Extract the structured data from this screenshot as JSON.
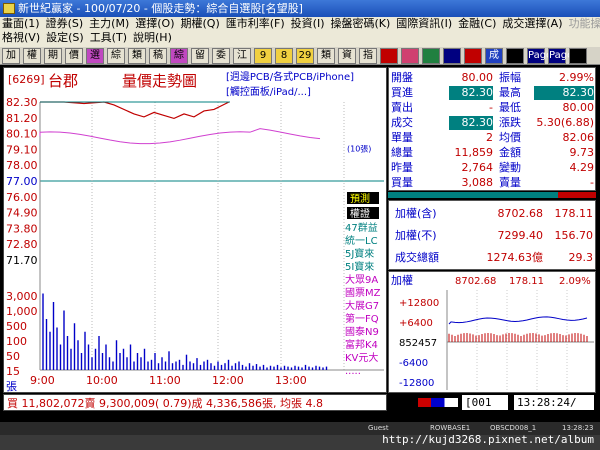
{
  "window": {
    "title": "新世紀贏家 - 100/07/20 - 個股走勢：綜合自選股[名望股]"
  },
  "menu": {
    "row1": [
      "畫面(1)",
      "證券(S)",
      "主力(M)",
      "選擇(O)",
      "期權(Q)",
      "匯市利率(F)",
      "投資(I)",
      "操盤密碼(K)",
      "國際資訊(I)",
      "金融(C)",
      "成交選擇(A)",
      "功能操作(F)"
    ],
    "row2": [
      "格視(V)",
      "設定(S)",
      "工具(T)",
      "說明(H)"
    ]
  },
  "toolbar": {
    "buttons": [
      "加",
      "權",
      "期",
      "價",
      "選",
      "綜",
      "類",
      "稿",
      "綜",
      "留",
      "委",
      "江",
      "9",
      "8",
      "29",
      "類",
      "資",
      "指",
      "",
      "",
      "",
      "",
      "",
      "成",
      "",
      "Page",
      "Page",
      ""
    ]
  },
  "stock": {
    "code": "[6269]",
    "name": "台郡",
    "chart_title": "量價走勢圖",
    "tag1": "[週邊PCB/各式PCB/iPhone]",
    "tag2": "[觸控面板/iPad/...]"
  },
  "price_axis": [
    "82.30",
    "81.20",
    "80.10",
    "79.10",
    "78.00",
    "77.00",
    "76.00",
    "74.90",
    "73.80",
    "72.80",
    "71.70"
  ],
  "volume_axis": [
    "3,000",
    "1,000",
    "500",
    "100",
    "50",
    "15",
    "張"
  ],
  "time_axis": [
    "9:00",
    "10:00",
    "11:00",
    "12:00",
    "13:00"
  ],
  "side_labels": {
    "predict": "預測",
    "ratio": "權證",
    "thousand": "(10張)",
    "list": [
      "47群益",
      "統一LC",
      "5J寶來",
      "5I寶來",
      "大眾9A",
      "國票MZ",
      "大展G7",
      "第一FQ",
      "國泰N9",
      "富邦K4",
      "KV元大",
      "....."
    ]
  },
  "quote": {
    "open": {
      "label": "開盤",
      "value": "80.00"
    },
    "amp": {
      "label": "振幅",
      "value": "2.99%"
    },
    "bid": {
      "label": "買進",
      "value": "82.30"
    },
    "high": {
      "label": "最高",
      "value": "82.30"
    },
    "ask": {
      "label": "賣出",
      "value": "-"
    },
    "low": {
      "label": "最低",
      "value": "80.00"
    },
    "deal": {
      "label": "成交",
      "value": "82.30"
    },
    "change": {
      "label": "漲跌",
      "value": "5.30(6.88)"
    },
    "unit": {
      "label": "單量",
      "value": "2"
    },
    "avg": {
      "label": "均價",
      "value": "82.06"
    },
    "total": {
      "label": "總量",
      "value": "11,859"
    },
    "amount": {
      "label": "金額",
      "value": "9.73"
    },
    "yvol": {
      "label": "昨量",
      "value": "2,764"
    },
    "chg2": {
      "label": "變動",
      "value": "4.29"
    },
    "buyvol": {
      "label": "買量",
      "value": "3,088"
    },
    "sellvol": {
      "label": "賣量",
      "value": "-"
    }
  },
  "index": {
    "r1": {
      "label": "加權(含)",
      "value": "8702.68",
      "diff": "178.11"
    },
    "r2": {
      "label": "加權(不)",
      "value": "7299.40",
      "diff": "156.70"
    },
    "r3": {
      "label": "成交總額",
      "value": "1274.63億",
      "diff": "29.3"
    }
  },
  "mini": {
    "label": "加權",
    "value": "8702.68",
    "diff": "178.11",
    "pct": "2.09%",
    "axis": [
      "+12800",
      "+6400",
      "852457",
      "-6400",
      "-12800"
    ]
  },
  "status": {
    "line": "買 11,802,072賣 9,300,009( 0.79)成 4,336,586張, 均張 4.8",
    "code": "[001",
    "time": "13:28:24/"
  },
  "footer": {
    "a": "Guest",
    "b": "ROWBASE1",
    "c": "OBSCD008_1",
    "d": "13:28:23"
  },
  "watermark": "http://kujd3268.pixnet.net/album",
  "chart_data": {
    "type": "line",
    "x": [
      "9:00",
      "10:00",
      "11:00",
      "12:00",
      "13:00"
    ],
    "price": [
      82.3,
      82.3,
      81.5,
      81.6,
      82.3
    ],
    "avg": [
      80.0,
      79.9,
      80.1,
      80.0,
      80.5
    ],
    "ylim": [
      71.7,
      82.3
    ],
    "reference": 77.0
  }
}
